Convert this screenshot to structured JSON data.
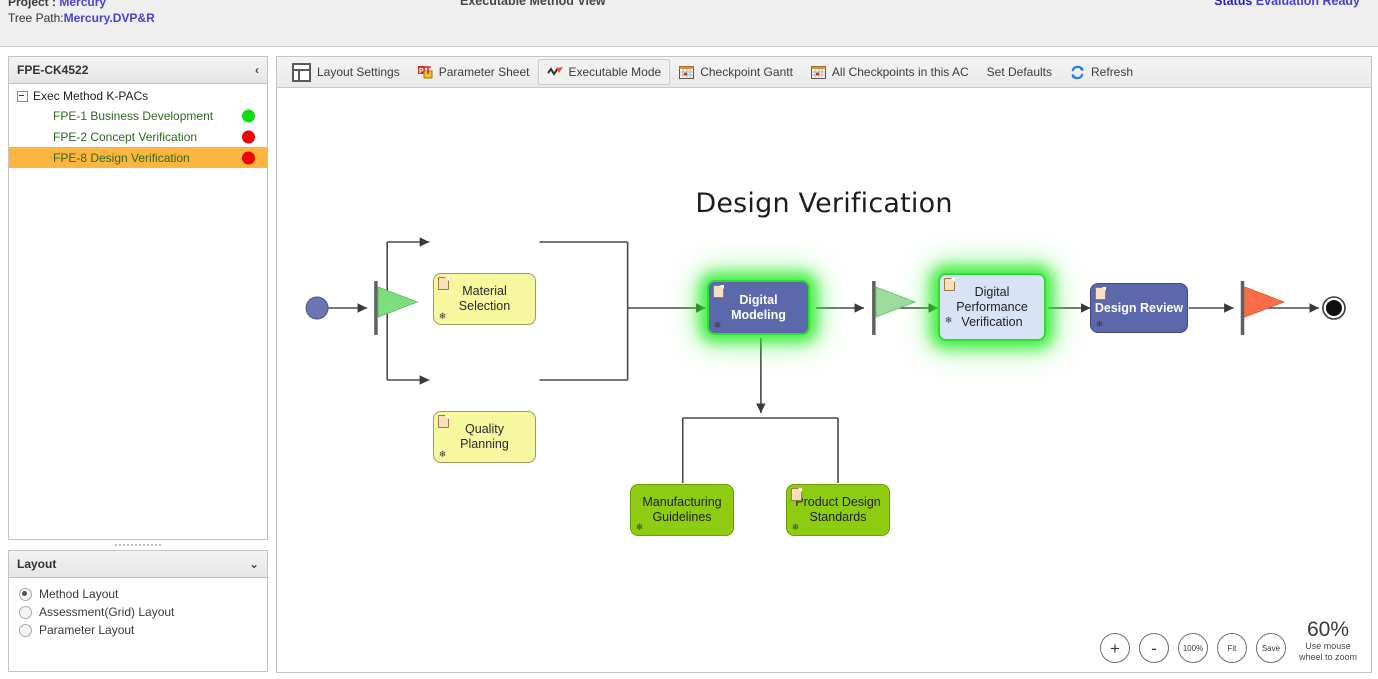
{
  "header": {
    "project_label": "Project :",
    "project_value": "Mercury",
    "treepath_label": "Tree Path:",
    "treepath_value": "Mercury.DVP&R",
    "view_title": "Executable Method View",
    "status_label": "Status",
    "status_value": "Evaluation Ready"
  },
  "sidebar": {
    "panel_title": "FPE-CK4522",
    "collapse_icon": "chevron-left-icon",
    "tree_root": "Exec Method K-PACs",
    "items": [
      {
        "label": "FPE-1 Business Development",
        "status": "green",
        "selected": false
      },
      {
        "label": "FPE-2 Concept Verification",
        "status": "red",
        "selected": false
      },
      {
        "label": "FPE-8 Design Verification",
        "status": "red",
        "selected": true
      }
    ],
    "layout_panel": {
      "title": "Layout",
      "expand_icon": "chevron-down-icon",
      "options": [
        {
          "label": "Method Layout",
          "checked": true
        },
        {
          "label": "Assessment(Grid) Layout",
          "checked": false
        },
        {
          "label": "Parameter Layout",
          "checked": false
        }
      ]
    }
  },
  "toolbar": {
    "buttons": [
      {
        "label": "Layout Settings",
        "icon": "layout-grid-icon",
        "active": false
      },
      {
        "label": "Parameter Sheet",
        "icon": "parameter-sheet-icon",
        "active": false
      },
      {
        "label": "Executable Mode",
        "icon": "executable-mode-icon",
        "active": true
      },
      {
        "label": "Checkpoint Gantt",
        "icon": "gantt-table-icon",
        "active": false
      },
      {
        "label": "All Checkpoints in this AC",
        "icon": "gantt-table-icon",
        "active": false
      },
      {
        "label": "Set Defaults",
        "icon": "none",
        "active": false
      },
      {
        "label": "Refresh",
        "icon": "refresh-icon",
        "active": false
      }
    ]
  },
  "diagram": {
    "title": "Design Verification",
    "nodes": [
      {
        "id": "material-selection",
        "label": "Material\nSelection",
        "line1": "Material",
        "line2": "Selection",
        "style": "yellow"
      },
      {
        "id": "quality-planning",
        "label": "Quality\nPlanning",
        "line1": "Quality",
        "line2": "Planning",
        "style": "yellow"
      },
      {
        "id": "digital-modeling",
        "line1": "Digital",
        "line2": "Modeling",
        "style": "blue-glow"
      },
      {
        "id": "digital-performance-verification",
        "line1": "Digital",
        "line2": "Performance",
        "line3": "Verification",
        "style": "ltblue-glow"
      },
      {
        "id": "design-review",
        "line1": "Design Review",
        "style": "blue"
      },
      {
        "id": "manufacturing-guidelines",
        "line1": "Manufacturing",
        "line2": "Guidelines",
        "style": "green"
      },
      {
        "id": "product-design-standards",
        "line1": "Product Design",
        "line2": "Standards",
        "style": "green"
      }
    ],
    "markers": [
      {
        "id": "start-node",
        "type": "start-circle"
      },
      {
        "id": "checkpoint-flag-1",
        "type": "flag",
        "color": "#7ede7e"
      },
      {
        "id": "checkpoint-flag-2",
        "type": "flag",
        "color": "#9ddc9d"
      },
      {
        "id": "checkpoint-flag-3",
        "type": "flag",
        "color": "#fb6d46"
      },
      {
        "id": "end-node",
        "type": "end-circle"
      }
    ]
  },
  "zoom_controls": {
    "zoom_in": "+",
    "zoom_out": "-",
    "reset": "100%",
    "fit": "Fit",
    "save": "Save",
    "level": "60%",
    "hint_line1": "Use mouse",
    "hint_line2": "wheel to zoom"
  },
  "colors": {
    "selected_row": "#fcb63f",
    "status_green": "#11dd11",
    "status_red": "#f00000",
    "glow": "#2fdc2f",
    "node_blue": "#5b68ab",
    "node_yellow": "#f7f7a0",
    "node_green": "#8ecc11",
    "link_text": "#4b3fd4"
  }
}
